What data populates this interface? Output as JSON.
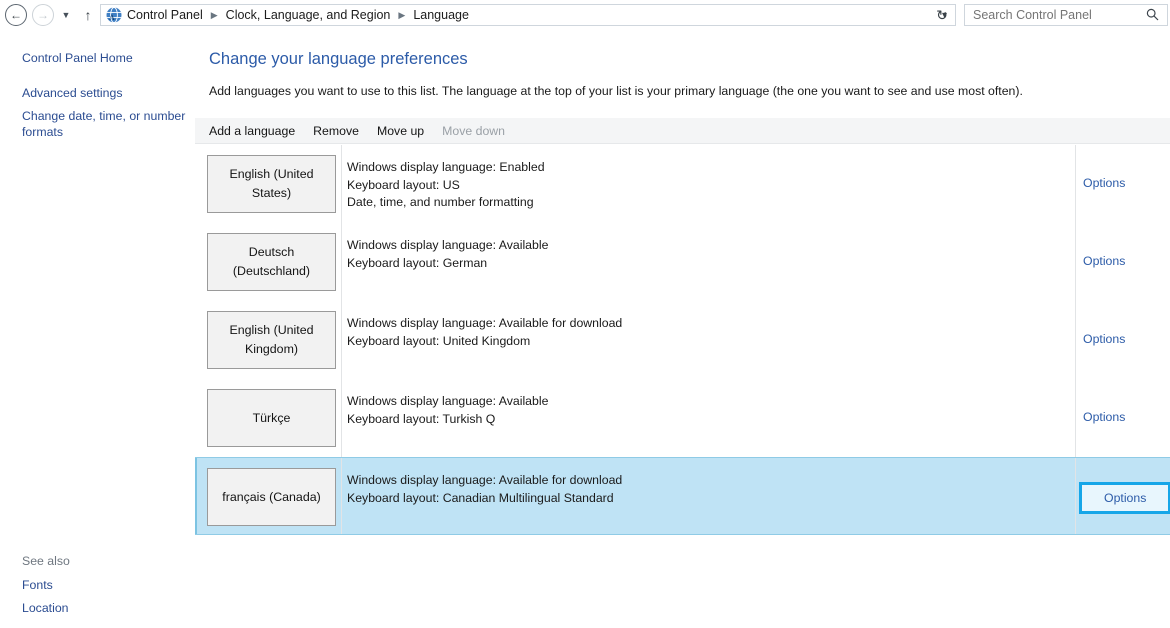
{
  "addressbar": {
    "back_icon": "back-arrow-icon",
    "forward_icon": "forward-arrow-icon",
    "history_icon": "history-dropdown-icon",
    "up_icon": "up-arrow-icon",
    "breadcrumb": [
      "Control Panel",
      "Clock, Language, and Region",
      "Language"
    ],
    "breadcrumb_separator": "▸",
    "dropdown_icon": "∨",
    "refresh_icon": "↻",
    "search_placeholder": "Search Control Panel",
    "search_value": "",
    "search_icon": "🔍"
  },
  "sidebar": {
    "home": "Control Panel Home",
    "advanced": "Advanced settings",
    "formats": "Change date, time, or number formats",
    "see_also_label": "See also",
    "fonts": "Fonts",
    "location": "Location"
  },
  "main": {
    "title": "Change your language preferences",
    "description": "Add languages you want to use to this list. The language at the top of your list is your primary language (the one you want to see and use most often).",
    "toolbar": {
      "add": "Add a language",
      "remove": "Remove",
      "move_up": "Move up",
      "move_down": "Move down"
    },
    "options_label": "Options",
    "languages": [
      {
        "name": "English (United States)",
        "display_language": "Windows display language: Enabled",
        "keyboard": "Keyboard layout: US",
        "extra": "Date, time, and number formatting",
        "options": "Options",
        "selected": false
      },
      {
        "name": "Deutsch (Deutschland)",
        "display_language": "Windows display language: Available",
        "keyboard": "Keyboard layout: German",
        "extra": "",
        "options": "Options",
        "selected": false
      },
      {
        "name": "English (United Kingdom)",
        "display_language": "Windows display language: Available for download",
        "keyboard": "Keyboard layout: United Kingdom",
        "extra": "",
        "options": "Options",
        "selected": false
      },
      {
        "name": "Türkçe",
        "display_language": "Windows display language: Available",
        "keyboard": "Keyboard layout: Turkish Q",
        "extra": "",
        "options": "Options",
        "selected": false
      },
      {
        "name": "français (Canada)",
        "display_language": "Windows display language: Available for download",
        "keyboard": "Keyboard layout: Canadian Multilingual Standard",
        "extra": "",
        "options": "Options",
        "selected": true
      }
    ]
  },
  "colors": {
    "link": "#2c5ba8",
    "title": "#2c5ba8",
    "selected_row": "#bfe3f5",
    "highlight_border": "#16a6e8",
    "toolbar_bg": "#f4f5f6"
  }
}
